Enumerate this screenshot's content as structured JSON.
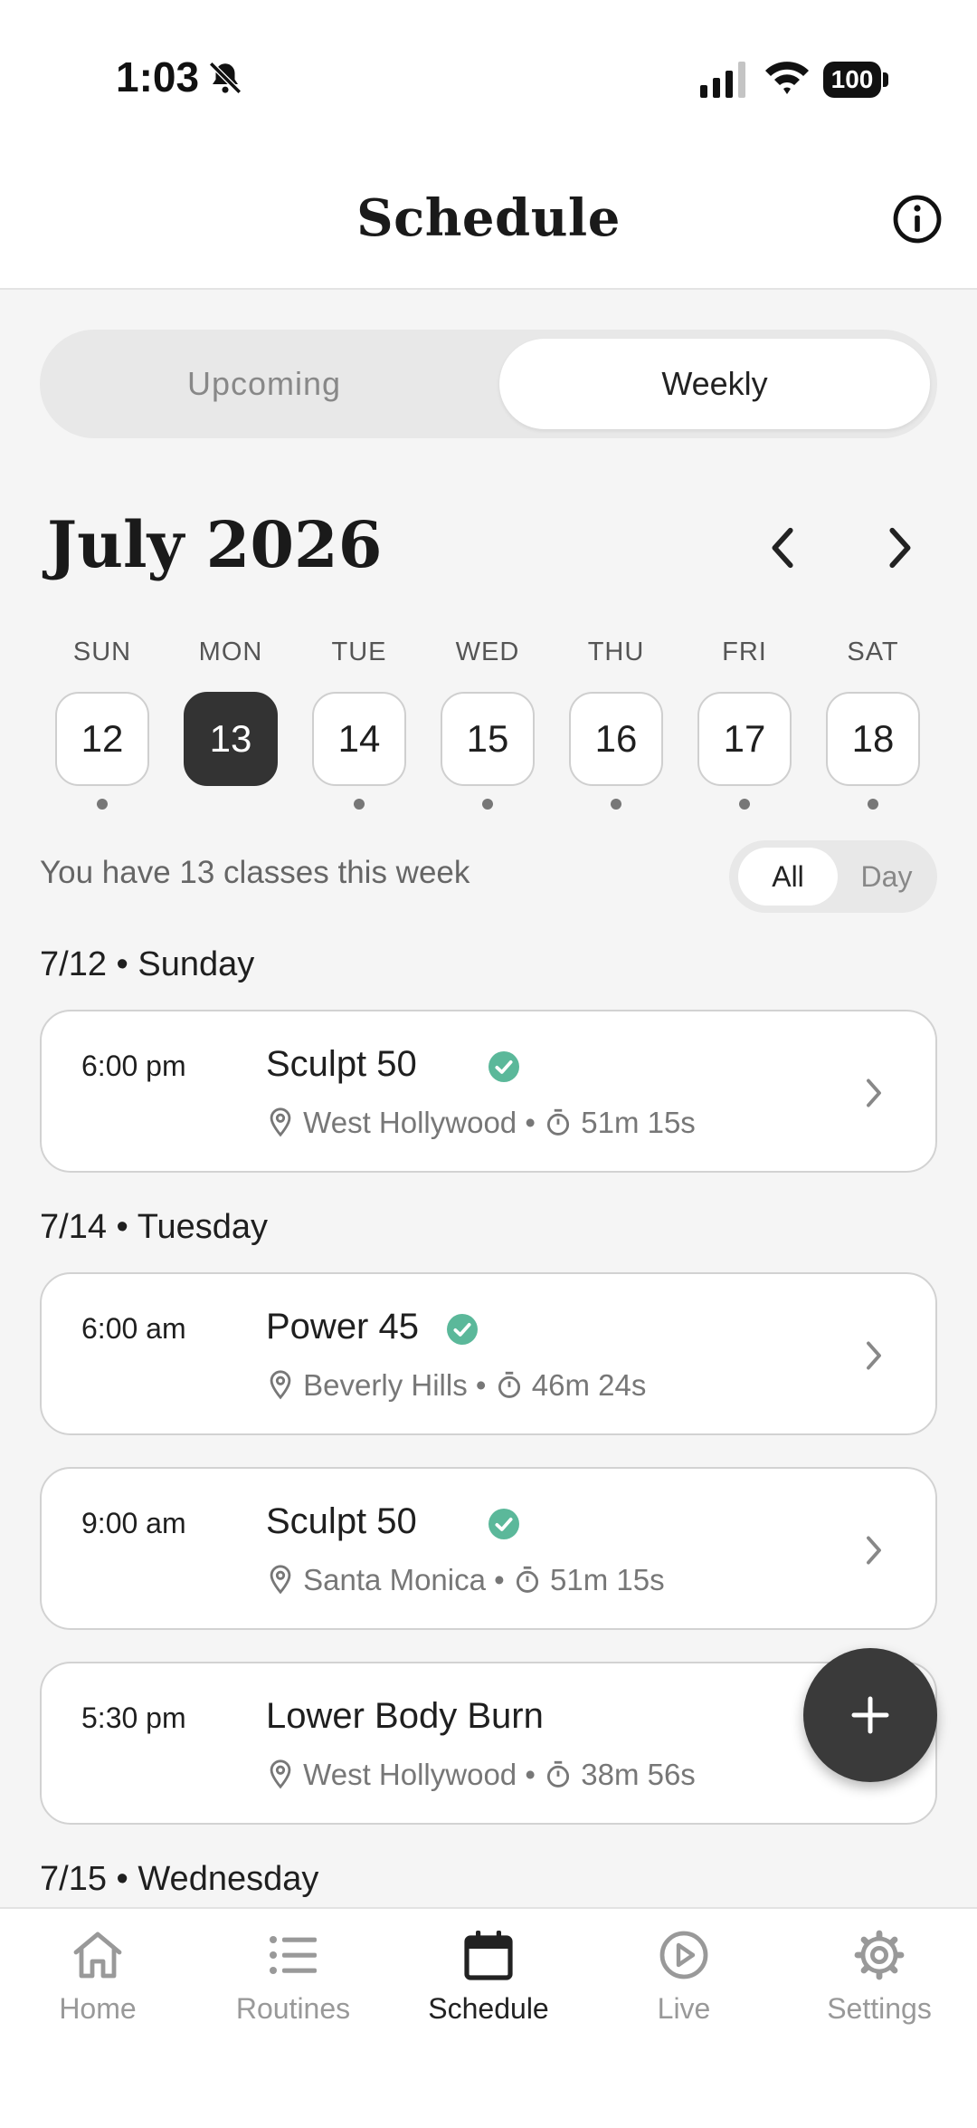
{
  "status": {
    "time": "1:03",
    "battery": "100"
  },
  "header": {
    "title": "Schedule"
  },
  "tabs": {
    "upcoming": "Upcoming",
    "weekly": "Weekly"
  },
  "calendar": {
    "month": "July 2026",
    "days": [
      {
        "dow": "SUN",
        "num": "12"
      },
      {
        "dow": "MON",
        "num": "13"
      },
      {
        "dow": "TUE",
        "num": "14"
      },
      {
        "dow": "WED",
        "num": "15"
      },
      {
        "dow": "THU",
        "num": "16"
      },
      {
        "dow": "FRI",
        "num": "17"
      },
      {
        "dow": "SAT",
        "num": "18"
      }
    ]
  },
  "summary": {
    "text": "You have 13 classes this week",
    "all": "All",
    "day": "Day"
  },
  "sections": [
    {
      "heading": "7/12 • Sunday"
    },
    {
      "heading": "7/14 • Tuesday"
    },
    {
      "heading": "7/15 • Wednesday"
    }
  ],
  "classes": [
    {
      "time": "6:00 pm",
      "name": "Sculpt 50",
      "location": "West Hollywood",
      "duration": "51m 15s"
    },
    {
      "time": "6:00 am",
      "name": "Power 45",
      "location": "Beverly Hills",
      "duration": "46m 24s"
    },
    {
      "time": "9:00 am",
      "name": "Sculpt 50",
      "location": "Santa Monica",
      "duration": "51m 15s"
    },
    {
      "time": "5:30 pm",
      "name": "Lower Body Burn",
      "location": "West Hollywood",
      "duration": "38m 56s"
    }
  ],
  "nav": {
    "home": "Home",
    "routines": "Routines",
    "schedule": "Schedule",
    "live": "Live",
    "settings": "Settings"
  },
  "colors": {
    "accent_dark": "#333333",
    "check_green": "#5bb89a"
  }
}
